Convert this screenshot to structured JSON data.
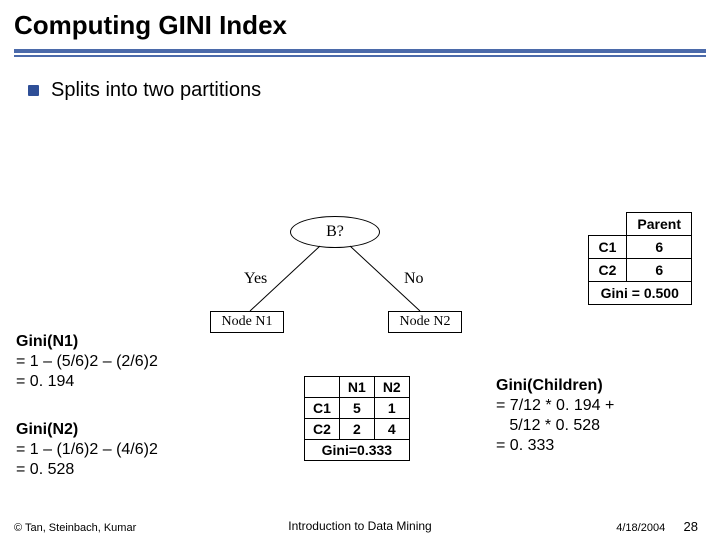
{
  "title": "Computing GINI Index",
  "bullet": "Splits into two partitions",
  "tree": {
    "root": "B?",
    "yes": "Yes",
    "no": "No",
    "leaf1": "Node N1",
    "leaf2": "Node N2"
  },
  "parent_table": {
    "header": "Parent",
    "rows": [
      {
        "label": "C1",
        "val": "6"
      },
      {
        "label": "C2",
        "val": "6"
      }
    ],
    "gini_label": "Gini = 0.500"
  },
  "child_table": {
    "cols": [
      "",
      "N1",
      "N2"
    ],
    "rows": [
      {
        "label": "C1",
        "v1": "5",
        "v2": "1"
      },
      {
        "label": "C2",
        "v1": "2",
        "v2": "4"
      }
    ],
    "gini_label": "Gini=0.333"
  },
  "gini_n1": {
    "l1": "Gini(N1)",
    "l2": "= 1 – (5/6)2 – (2/6)2",
    "l3": "= 0. 194"
  },
  "gini_n2": {
    "l1": "Gini(N2)",
    "l2": "= 1 – (1/6)2 – (4/6)2",
    "l3": "= 0. 528"
  },
  "gini_children": {
    "l1": "Gini(Children)",
    "l2": "= 7/12 * 0. 194 +",
    "l3": "   5/12 * 0. 528",
    "l4": "= 0. 333"
  },
  "footer": {
    "left": "© Tan, Steinbach, Kumar",
    "mid": "Introduction to Data Mining",
    "date": "4/18/2004",
    "page": "28"
  },
  "chart_data": {
    "type": "table",
    "title": "GINI index computation for binary split on attribute B",
    "parent": {
      "C1": 6,
      "C2": 6,
      "gini": 0.5
    },
    "split": {
      "attribute": "B",
      "branches": {
        "Yes": {
          "node": "N1",
          "C1": 5,
          "C2": 2,
          "gini": 0.194,
          "weight": "7/12"
        },
        "No": {
          "node": "N2",
          "C1": 1,
          "C2": 4,
          "gini": 0.528,
          "weight": "5/12"
        }
      },
      "children_gini": 0.333
    }
  }
}
